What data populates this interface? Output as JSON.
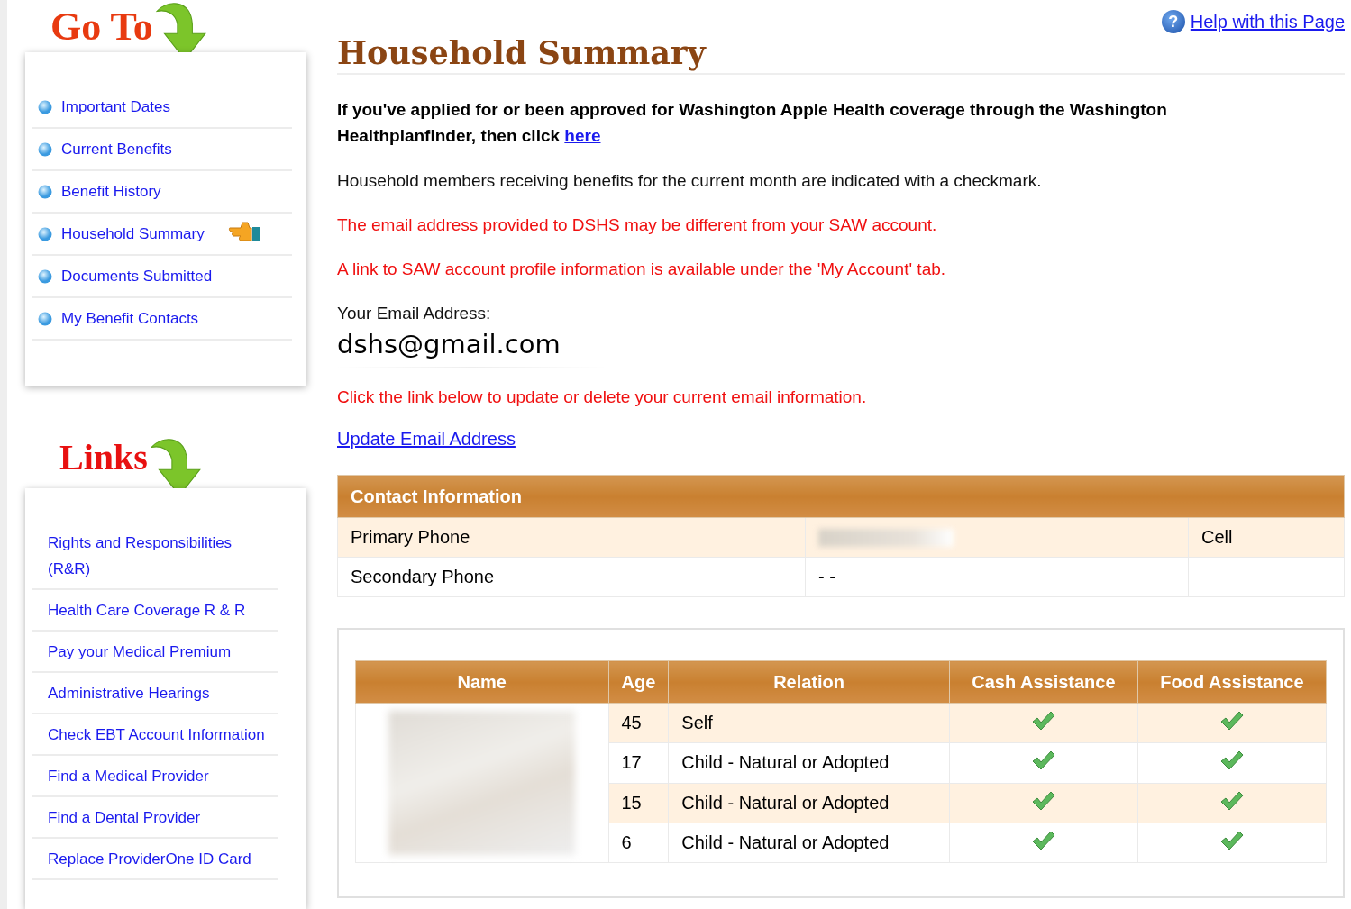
{
  "goto": {
    "title": "Go To",
    "items": [
      {
        "label": "Important Dates",
        "selected": false
      },
      {
        "label": "Current Benefits",
        "selected": false
      },
      {
        "label": "Benefit History",
        "selected": false
      },
      {
        "label": "Household Summary",
        "selected": true
      },
      {
        "label": "Documents Submitted",
        "selected": false
      },
      {
        "label": "My Benefit Contacts",
        "selected": false
      }
    ]
  },
  "links": {
    "title": "Links",
    "items": [
      "Rights and Responsibilities (R&R)",
      "Health Care Coverage R & R",
      "Pay your Medical Premium",
      "Administrative Hearings",
      "Check EBT Account Information",
      "Find a Medical Provider",
      "Find a Dental Provider",
      "Replace ProviderOne ID Card"
    ]
  },
  "help": {
    "icon": "?",
    "label": "Help with this Page"
  },
  "page_title": "Household Summary",
  "notice": {
    "text": "If you've applied for or been approved for Washington Apple Health coverage through the Washington Healthplanfinder, then click",
    "link": "here"
  },
  "info": "Household members receiving benefits for the current month are indicated with a checkmark.",
  "warnings": [
    "The email address provided to DSHS may be different from your SAW account.",
    "A link to SAW account profile information is available under the 'My Account' tab."
  ],
  "email_label": "Your Email Address:",
  "email": "dshs@gmail.com",
  "update_note": "Click the link below to update or delete your current email information.",
  "update_link": "Update Email Address",
  "contact": {
    "title": "Contact Information",
    "rows": [
      {
        "label": "Primary Phone",
        "value": null,
        "type": "Cell"
      },
      {
        "label": "Secondary Phone",
        "value": "- -",
        "type": null
      }
    ]
  },
  "household": {
    "columns": [
      "Name",
      "Age",
      "Relation",
      "Cash Assistance",
      "Food Assistance"
    ],
    "rows": [
      {
        "age": "45",
        "relation": "Self",
        "cash": true,
        "food": true
      },
      {
        "age": "17",
        "relation": "Child - Natural or Adopted",
        "cash": true,
        "food": true
      },
      {
        "age": "15",
        "relation": "Child - Natural or Adopted",
        "cash": true,
        "food": true
      },
      {
        "age": "6",
        "relation": "Child - Natural or Adopted",
        "cash": true,
        "food": true
      }
    ]
  }
}
